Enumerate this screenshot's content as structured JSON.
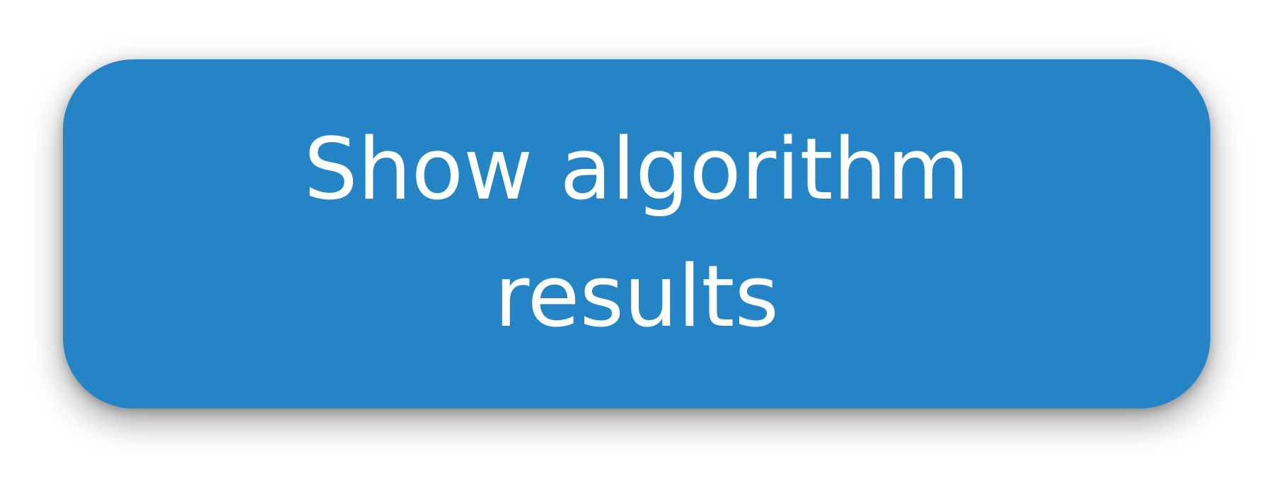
{
  "button": {
    "label": "Show algorithm results"
  },
  "colors": {
    "page_background": "#ffffff",
    "button_background": "#2484c6",
    "button_text": "#ffffff"
  }
}
